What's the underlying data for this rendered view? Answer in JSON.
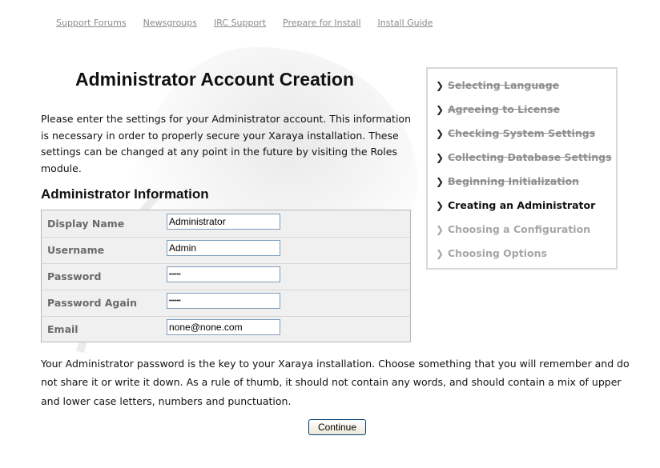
{
  "nav": {
    "links": [
      "Support Forums",
      "Newsgroups",
      "IRC Support",
      "Prepare for Install",
      "Install Guide"
    ]
  },
  "page_title": "Administrator Account Creation",
  "intro": "Please enter the settings for your Administrator account. This information is necessary in order to properly secure your Xaraya installation. These settings can be changed at any point in the future by visiting the Roles module.",
  "section_heading": "Administrator Information",
  "form": {
    "display_name": {
      "label": "Display Name",
      "value": "Administrator"
    },
    "username": {
      "label": "Username",
      "value": "Admin"
    },
    "password": {
      "label": "Password",
      "value": "******"
    },
    "password_again": {
      "label": "Password Again",
      "value": "******"
    },
    "email": {
      "label": "Email",
      "value": "none@none.com"
    }
  },
  "steps": [
    {
      "label": "Selecting Language",
      "state": "done"
    },
    {
      "label": "Agreeing to License",
      "state": "done"
    },
    {
      "label": "Checking System Settings",
      "state": "done"
    },
    {
      "label": "Collecting Database Settings",
      "state": "done"
    },
    {
      "label": "Beginning Initialization",
      "state": "done"
    },
    {
      "label": "Creating an Administrator",
      "state": "current"
    },
    {
      "label": "Choosing a Configuration",
      "state": "todo"
    },
    {
      "label": "Choosing Options",
      "state": "todo"
    }
  ],
  "note": "Your Administrator password is the key to your Xaraya installation. Choose something that you will remember and do not share it or write it down. As a rule of thumb, it should not contain any words, and should contain a mix of upper and lower case letters, numbers and punctuation.",
  "continue_label": "Continue",
  "icons": {
    "step_arrow": "chevron-right-icon"
  }
}
